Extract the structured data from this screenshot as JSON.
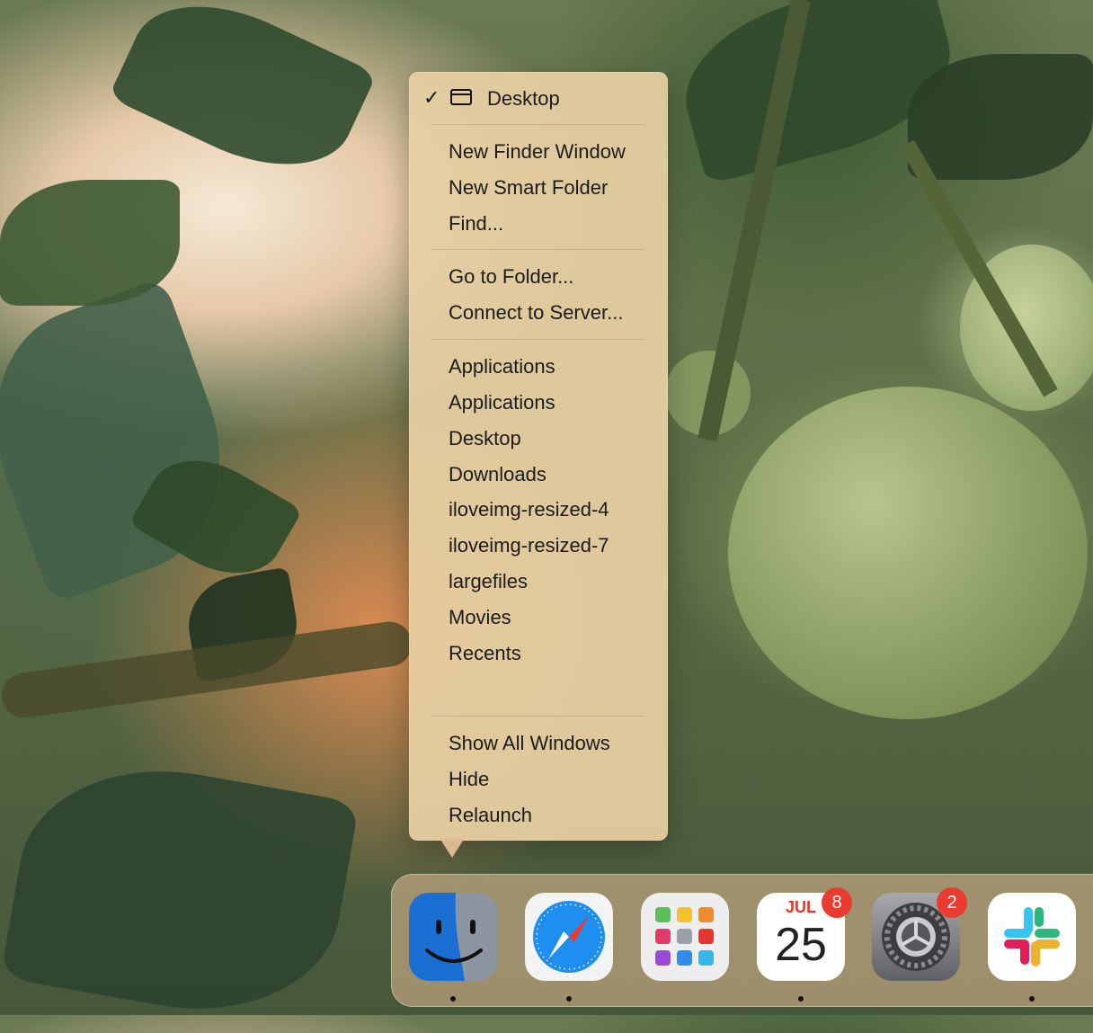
{
  "menu": {
    "current": "Desktop",
    "group1": [
      "New Finder Window",
      "New Smart Folder",
      "Find..."
    ],
    "group2": [
      "Go to Folder...",
      "Connect to Server..."
    ],
    "folders": [
      "Applications",
      "Applications",
      "Desktop",
      "Downloads",
      "iloveimg-resized-4",
      "iloveimg-resized-7",
      "largefiles",
      "Movies",
      "Recents"
    ],
    "group4": [
      "Show All Windows",
      "Hide",
      "Relaunch"
    ]
  },
  "dock": {
    "apps": [
      {
        "name": "Finder",
        "icon": "finder-icon",
        "running": true
      },
      {
        "name": "Safari",
        "icon": "safari-icon",
        "running": true
      },
      {
        "name": "Launchpad",
        "icon": "launchpad-icon",
        "running": false
      },
      {
        "name": "Calendar",
        "icon": "calendar-icon",
        "running": true,
        "badge": "8",
        "month": "JUL",
        "day": "25"
      },
      {
        "name": "System Settings",
        "icon": "gear-icon",
        "running": false,
        "badge": "2"
      },
      {
        "name": "Slack",
        "icon": "slack-icon",
        "running": true
      }
    ]
  },
  "colors": {
    "menu_bg": "#e7d0a2",
    "badge": "#ea3b30",
    "safari_blue": "#1f8ef1"
  }
}
